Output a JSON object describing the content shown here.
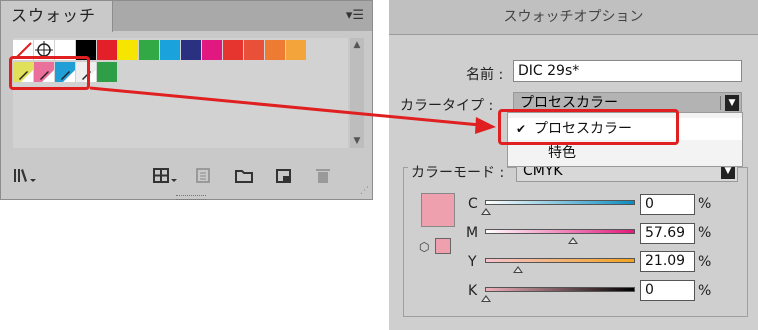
{
  "swatches_panel": {
    "tab_label": "スウォッチ",
    "menu_icon": "panel-menu-icon",
    "row1_colors": [
      "#ffffff",
      "#ffffff",
      "#ffffff",
      "#000000",
      "#e3202a",
      "#f6e500",
      "#33a946",
      "#1aa2dc",
      "#2a3180",
      "#e0187f",
      "#e6352f",
      "#e9503a",
      "#ee7b32",
      "#f3a43b"
    ],
    "row2_colors": [
      "#e0e05a",
      "#ea6f9a",
      "#1f9fd6",
      "#eeeeee",
      "#2e9f46"
    ],
    "bottom_icons": [
      "library-icon",
      "grid-view-icon",
      "swatch-options-icon",
      "new-group-icon",
      "new-swatch-icon",
      "delete-icon"
    ]
  },
  "dialog": {
    "title": "スウォッチオプション",
    "name_label": "名前 :",
    "name_value": "DIC 29s*",
    "type_label": "カラータイプ :",
    "type_value": "プロセスカラー",
    "mode_label": "カラーモード :",
    "mode_value": "CMYK",
    "channels": [
      {
        "label": "C",
        "value": "0",
        "position": 0,
        "gradient": [
          "#ffffff",
          "#0b8cbf"
        ]
      },
      {
        "label": "M",
        "value": "57.69",
        "position": 57.69,
        "gradient": [
          "#ffffff",
          "#e2197e"
        ]
      },
      {
        "label": "Y",
        "value": "21.09",
        "position": 21.09,
        "gradient": [
          "#f7c2cf",
          "#f2a31b"
        ]
      },
      {
        "label": "K",
        "value": "0",
        "position": 0,
        "gradient": [
          "#f0b0bc",
          "#000000"
        ]
      }
    ],
    "percent": "%",
    "swatch_color": "#efa0ae"
  },
  "dropdown": {
    "options": [
      {
        "label": "プロセスカラー",
        "checked": true,
        "check_mark": "✔"
      },
      {
        "label": "特色",
        "checked": false
      }
    ]
  },
  "accent_red": "#e02020"
}
